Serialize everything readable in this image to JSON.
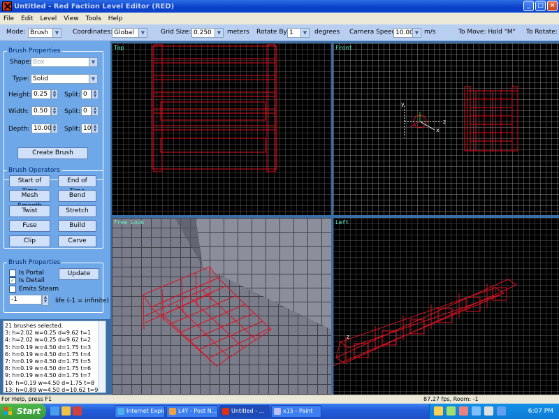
{
  "window": {
    "title": "Untitled - Red Faction Level Editor (RED)",
    "minimize": "_",
    "maximize": "□",
    "close": "×"
  },
  "menu": [
    "File",
    "Edit",
    "Level",
    "View",
    "Tools",
    "Help"
  ],
  "toolbar": {
    "mode_label": "Mode:",
    "mode_value": "Brush",
    "coords_label": "Coordinates:",
    "coords_value": "Global",
    "grid_label": "Grid Size:",
    "grid_value": "0.250",
    "grid_unit": "meters",
    "rotate_label": "Rotate By:",
    "rotate_value": "1",
    "rotate_unit": "degrees",
    "camera_label": "Camera Speed:",
    "camera_value": "10.00",
    "camera_unit": "m/s",
    "move_hint": "To Move: Hold \"M\"",
    "rotate_hint": "To Rotate:"
  },
  "brush_properties": {
    "title": "Brush Properties",
    "shape_label": "Shape:",
    "shape_value": "Box",
    "type_label": "Type:",
    "type_value": "Solid",
    "height_label": "Height:",
    "height_value": "0.25",
    "width_label": "Width:",
    "width_value": "0.50",
    "depth_label": "Depth:",
    "depth_value": "10.00",
    "split_label": "Split:",
    "split_height": "0",
    "split_width": "0",
    "split_depth": "10",
    "create_button": "Create Brush"
  },
  "brush_operators": {
    "title": "Brush Operators",
    "buttons": [
      "Start of Time",
      "End of Time",
      "Mesh Smooth",
      "Bend",
      "Twist",
      "Stretch",
      "Fuse",
      "Build",
      "Clip",
      "Carve"
    ]
  },
  "brush_flags": {
    "title": "Brush Properties",
    "is_portal": "Is Portal",
    "is_detail": "Is Detail",
    "emits_steam": "Emits Steam",
    "update_button": "Update",
    "life_value": "-1",
    "life_label": "life (-1 = infinite)",
    "is_portal_checked": false,
    "is_detail_checked": true,
    "emits_steam_checked": false
  },
  "console": {
    "lines": [
      "21 brushes selected.",
      "3: h=2.02 w=0.25 d=9.62 t=1",
      "4: h=2.02 w=0.25 d=9.62 t=2",
      "5: h=0.19 w=4.50 d=1.75 t=3",
      "6: h=0.19 w=4.50 d=1.75 t=4",
      "7: h=0.19 w=4.50 d=1.75 t=5",
      "8: h=0.19 w=4.50 d=1.75 t=6",
      "9: h=0.19 w=4.50 d=1.75 t=7",
      "10: h=0.19 w=4.50 d=1.75 t=8",
      "13: h=0.89 w=4.50 d=10.62 t=9"
    ]
  },
  "viewports": {
    "top": "Top",
    "perspective": "Front",
    "freelook": "Free Look",
    "left": "Left",
    "axis_x": "x",
    "axis_y": "y",
    "axis_z": "z"
  },
  "status": {
    "help": "For Help, press F1",
    "fps": "87.27 fps, Room: -1"
  },
  "taskbar": {
    "start": "Start",
    "tasks": [
      "Internet Explorer",
      "L4Y - Post N...",
      "Untitled - ...",
      "x15 - Paint"
    ],
    "clock": "6:07 PM"
  },
  "colors": {
    "wire": "#e01020",
    "grid_dark": "#5a5a5a",
    "grid_light": "#9a9a9a",
    "xp_blue": "#245edb"
  }
}
